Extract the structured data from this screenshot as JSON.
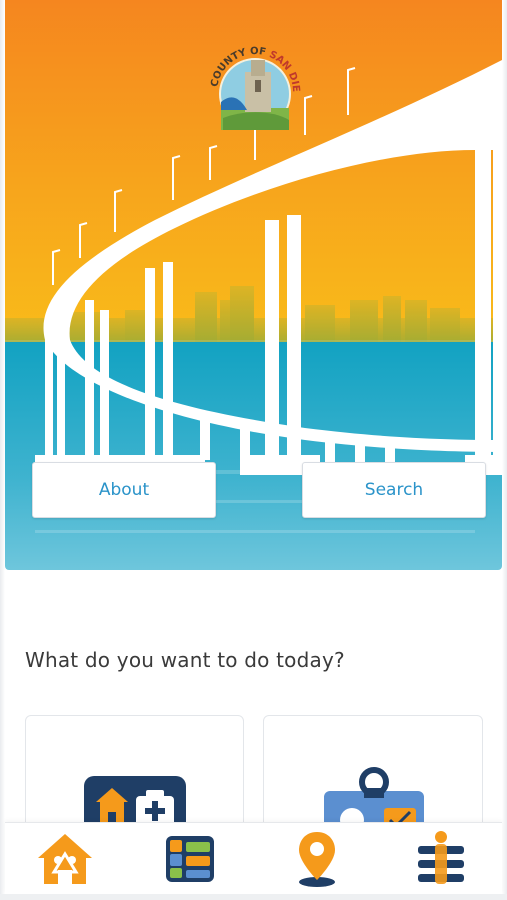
{
  "hero": {
    "seal": {
      "text_top": "COUNTY OF",
      "text_name": "SAN DIEGO"
    },
    "about_button": "About",
    "search_button": "Search"
  },
  "main": {
    "prompt": "What do you want to do today?",
    "cards": [
      {
        "icon": "home-health-services-icon"
      },
      {
        "icon": "id-badge-check-icon"
      }
    ]
  },
  "bottom_nav": {
    "items": [
      {
        "icon": "family-home-icon"
      },
      {
        "icon": "services-directory-icon"
      },
      {
        "icon": "location-pin-icon"
      },
      {
        "icon": "menu-person-icon"
      }
    ]
  },
  "colors": {
    "accent_orange": "#f59a1b",
    "accent_blue": "#2a93c9",
    "navy": "#1f3e66",
    "sky_top": "#f5871f",
    "sky_bottom": "#f8b318",
    "water": "#1aa6c4"
  }
}
